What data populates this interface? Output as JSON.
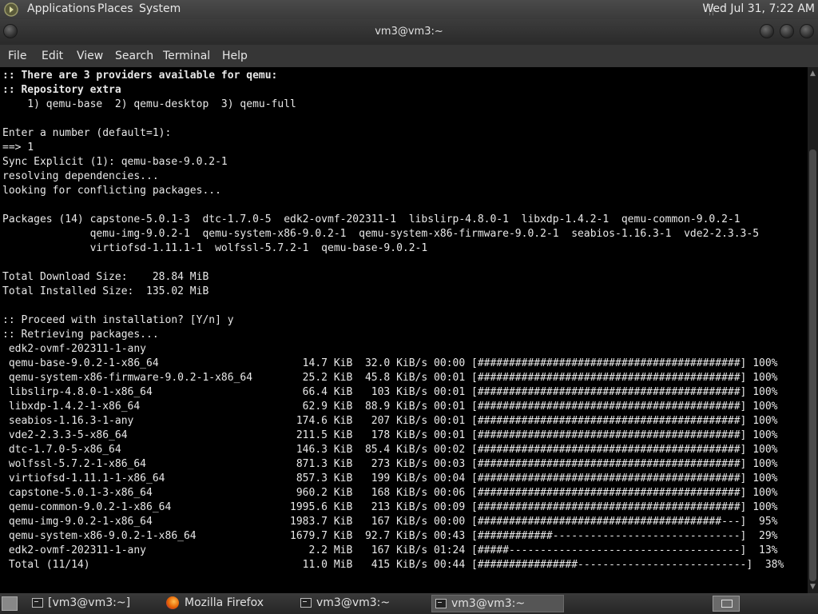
{
  "top_panel": {
    "menus": [
      "Applications",
      "Places",
      "System"
    ],
    "clock": "Wed Jul 31,  7:22 AM"
  },
  "window": {
    "title": "vm3@vm3:~",
    "menus": [
      "File",
      "Edit",
      "View",
      "Search",
      "Terminal",
      "Help"
    ]
  },
  "terminal": {
    "lines": [
      {
        "text": ":: There are 3 providers available for qemu:",
        "bold": true
      },
      {
        "text": ":: Repository extra",
        "bold": true
      },
      {
        "text": "    1) qemu-base  2) qemu-desktop  3) qemu-full",
        "bold": false
      },
      {
        "text": "",
        "bold": false
      },
      {
        "text": "Enter a number (default=1):",
        "bold": false
      },
      {
        "text": "==> 1",
        "bold": false
      },
      {
        "text": "Sync Explicit (1): qemu-base-9.0.2-1",
        "bold": false
      },
      {
        "text": "resolving dependencies...",
        "bold": false
      },
      {
        "text": "looking for conflicting packages...",
        "bold": false
      },
      {
        "text": "",
        "bold": false
      },
      {
        "text": "Packages (14) capstone-5.0.1-3  dtc-1.7.0-5  edk2-ovmf-202311-1  libslirp-4.8.0-1  libxdp-1.4.2-1  qemu-common-9.0.2-1",
        "bold": false
      },
      {
        "text": "              qemu-img-9.0.2-1  qemu-system-x86-9.0.2-1  qemu-system-x86-firmware-9.0.2-1  seabios-1.16.3-1  vde2-2.3.3-5",
        "bold": false
      },
      {
        "text": "              virtiofsd-1.11.1-1  wolfssl-5.7.2-1  qemu-base-9.0.2-1",
        "bold": false
      },
      {
        "text": "",
        "bold": false
      },
      {
        "text": "Total Download Size:    28.84 MiB",
        "bold": false
      },
      {
        "text": "Total Installed Size:  135.02 MiB",
        "bold": false
      },
      {
        "text": "",
        "bold": false
      },
      {
        "text": ":: Proceed with installation? [Y/n] y",
        "bold": false
      },
      {
        "text": ":: Retrieving packages...",
        "bold": false
      },
      {
        "text": " edk2-ovmf-202311-1-any",
        "bold": false
      },
      {
        "text": " qemu-base-9.0.2-1-x86_64                       14.7 KiB  32.0 KiB/s 00:00 [##########################################] 100%",
        "bold": false
      },
      {
        "text": " qemu-system-x86-firmware-9.0.2-1-x86_64        25.2 KiB  45.8 KiB/s 00:01 [##########################################] 100%",
        "bold": false
      },
      {
        "text": " libslirp-4.8.0-1-x86_64                        66.4 KiB   103 KiB/s 00:01 [##########################################] 100%",
        "bold": false
      },
      {
        "text": " libxdp-1.4.2-1-x86_64                          62.9 KiB  88.9 KiB/s 00:01 [##########################################] 100%",
        "bold": false
      },
      {
        "text": " seabios-1.16.3-1-any                          174.6 KiB   207 KiB/s 00:01 [##########################################] 100%",
        "bold": false
      },
      {
        "text": " vde2-2.3.3-5-x86_64                           211.5 KiB   178 KiB/s 00:01 [##########################################] 100%",
        "bold": false
      },
      {
        "text": " dtc-1.7.0-5-x86_64                            146.3 KiB  85.4 KiB/s 00:02 [##########################################] 100%",
        "bold": false
      },
      {
        "text": " wolfssl-5.7.2-1-x86_64                        871.3 KiB   273 KiB/s 00:03 [##########################################] 100%",
        "bold": false
      },
      {
        "text": " virtiofsd-1.11.1-1-x86_64                     857.3 KiB   199 KiB/s 00:04 [##########################################] 100%",
        "bold": false
      },
      {
        "text": " capstone-5.0.1-3-x86_64                       960.2 KiB   168 KiB/s 00:06 [##########################################] 100%",
        "bold": false
      },
      {
        "text": " qemu-common-9.0.2-1-x86_64                   1995.6 KiB   213 KiB/s 00:09 [##########################################] 100%",
        "bold": false
      },
      {
        "text": " qemu-img-9.0.2-1-x86_64                      1983.7 KiB   167 KiB/s 00:00 [#######################################---]  95%",
        "bold": false
      },
      {
        "text": " qemu-system-x86-9.0.2-1-x86_64               1679.7 KiB  92.7 KiB/s 00:43 [############------------------------------]  29%",
        "bold": false
      },
      {
        "text": " edk2-ovmf-202311-1-any                          2.2 MiB   167 KiB/s 01:24 [#####-------------------------------------]  13%",
        "bold": false
      },
      {
        "text": " Total (11/14)                                  11.0 MiB   415 KiB/s 00:44 [################---------------------------]  38%",
        "bold": false
      }
    ]
  },
  "taskbar": {
    "tasks": [
      {
        "label": "[vm3@vm3:~]",
        "icon": "terminal-icon",
        "active": false
      },
      {
        "label": "Mozilla Firefox",
        "icon": "firefox-icon",
        "active": false
      },
      {
        "label": "vm3@vm3:~",
        "icon": "terminal-icon",
        "active": false
      },
      {
        "label": "vm3@vm3:~",
        "icon": "terminal-icon",
        "active": true
      }
    ]
  }
}
